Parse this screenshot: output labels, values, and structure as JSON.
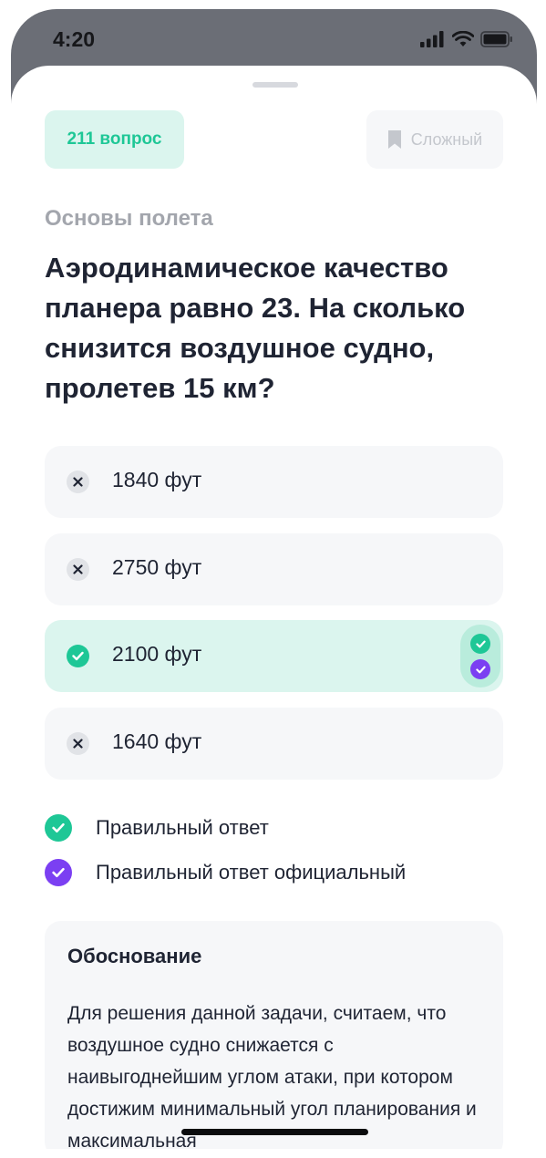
{
  "status_bar": {
    "time": "4:20"
  },
  "header": {
    "question_badge": "211 вопрос",
    "difficulty_label": "Сложный"
  },
  "category": "Основы полета",
  "question": "Аэродинамическое качество планера равно 23. На сколько снизится воздушное судно, пролетев 15 км?",
  "answers": [
    {
      "text": "1840 фут",
      "state": "wrong"
    },
    {
      "text": "2750 фут",
      "state": "wrong"
    },
    {
      "text": "2100 фут",
      "state": "correct"
    },
    {
      "text": "1640 фут",
      "state": "wrong"
    }
  ],
  "legend": {
    "correct": "Правильный ответ",
    "official": "Правильный ответ официальный"
  },
  "explanation": {
    "title": "Обоснование",
    "body": "Для решения данной задачи, считаем, что воздушное судно снижается с наивыгоднейшим углом атаки, при котором достижим минимальный угол планирования и максимальная"
  },
  "colors": {
    "correct_green": "#1ec796",
    "official_purple": "#7b3ff2",
    "correct_bg": "#dbf5ee",
    "neutral_bg": "#f6f7f9",
    "text_dark": "#1f2433",
    "muted": "#a3a6ad"
  },
  "icons": {
    "wrong": "close-icon",
    "correct": "check-icon",
    "official": "check-icon",
    "difficulty": "bookmark-icon"
  }
}
